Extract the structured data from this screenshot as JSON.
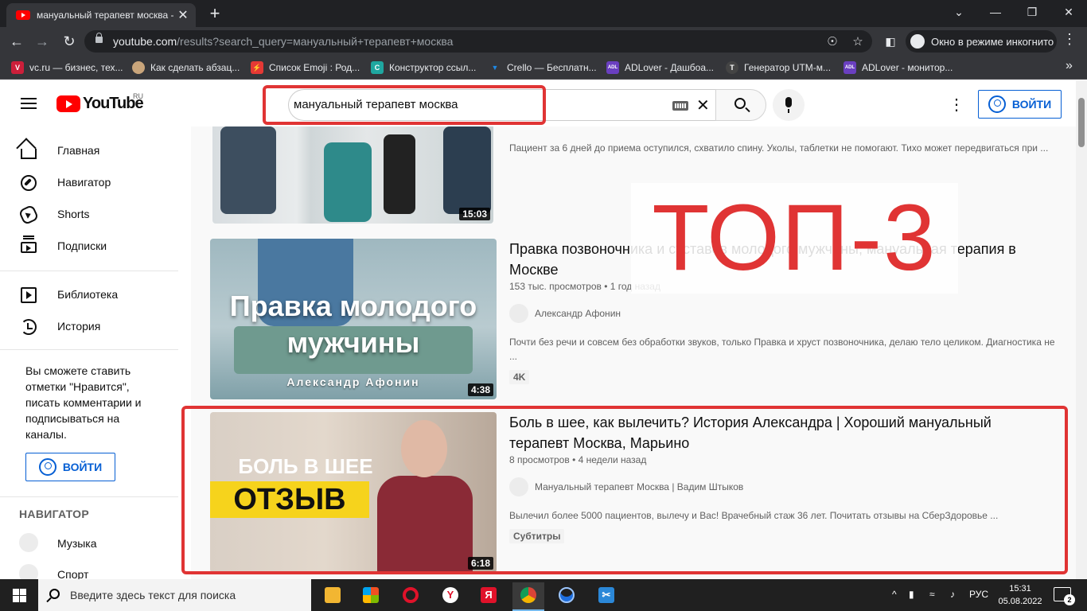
{
  "browser": {
    "tab_title": "мануальный терапевт москва - YouTube",
    "tab_close": "✕",
    "new_tab": "+",
    "window_controls": {
      "minimize": "—",
      "restore": "❐",
      "close": "✕",
      "tab_search": "⌄"
    },
    "url_host": "youtube.com",
    "url_path": "/results?search_query=мануальный+терапевт+москва",
    "incognito_label": "Окно в режиме инкогнито",
    "bookmarks": [
      {
        "label": "vc.ru — бизнес, тех...",
        "color": "#cc1f3a",
        "glyph": "V"
      },
      {
        "label": "Как сделать абзац...",
        "color": "#c9a57b",
        "glyph": ""
      },
      {
        "label": "Список Emoji : Род...",
        "color": "#e53935",
        "glyph": "⚡"
      },
      {
        "label": "Конструктор ссыл...",
        "color": "#1fa7a0",
        "glyph": "C"
      },
      {
        "label": "Crello — Бесплатн...",
        "color": "#1e88e5",
        "glyph": "▼"
      },
      {
        "label": "ADLover - Дашбоа...",
        "color": "#6a3fc0",
        "glyph": "ADL"
      },
      {
        "label": "Генератор UTM-м...",
        "color": "#444444",
        "glyph": "T"
      },
      {
        "label": "ADLover - монитор...",
        "color": "#6a3fc0",
        "glyph": "ADL"
      }
    ],
    "bookmarks_more": "»"
  },
  "youtube": {
    "logo_text": "YouTube",
    "logo_country": "RU",
    "search_query": "мануальный терапевт москва",
    "signin_label": "ВОЙТИ",
    "sidebar": {
      "main": [
        "Главная",
        "Навигатор",
        "Shorts",
        "Подписки"
      ],
      "library": [
        "Библиотека",
        "История"
      ],
      "note": "Вы сможете ставить отметки \"Нравится\", писать комментарии и подписываться на каналы.",
      "signin_label": "ВОЙТИ",
      "heading": "НАВИГАТОР",
      "channels": [
        "Музыка",
        "Спорт"
      ]
    },
    "results": [
      {
        "title": "",
        "description": "Пациент за 6 дней до приема оступился, схватило спину. Уколы, таблетки не помогают. Тихо может передвигаться при ...",
        "duration": "15:03"
      },
      {
        "title": "Правка позвоночника и суставов молодого мужчины, мануальная терапия в Москве",
        "views": "153 тыс. просмотров",
        "age": "1 год назад",
        "channel": "Александр Афонин",
        "description": "Почти без речи и совсем без обработки звуков, только Правка и хруст позвоночника, делаю тело целиком. Диагностика не ...",
        "badge": "4K",
        "duration": "4:38",
        "thumb_title": "Правка молодого мужчины",
        "thumb_author": "Александр Афонин"
      },
      {
        "title": "Боль в шее, как вылечить? История Александра | Хороший мануальный терапевт Москва, Марьино",
        "views": "8 просмотров",
        "age": "4 недели назад",
        "channel": "Мануальный терапевт Москва | Вадим Штыков",
        "description": "Вылечил более 5000 пациентов, вылечу и Вас! Врачебный стаж 36 лет.    Почитать отзывы на СберЗдоровье ...",
        "badge": "Субтитры",
        "duration": "6:18",
        "thumb_line1": "БОЛЬ В ШЕЕ",
        "thumb_line2": "ОТЗЫВ"
      }
    ],
    "separator": "•",
    "overlay_text": "ТОП-3",
    "overlay_color": "#e03434"
  },
  "taskbar": {
    "search_placeholder": "Введите здесь текст для поиска",
    "language": "РУС",
    "time": "15:31",
    "date": "05.08.2022",
    "notifications": "2",
    "tray_chevron": "^"
  }
}
